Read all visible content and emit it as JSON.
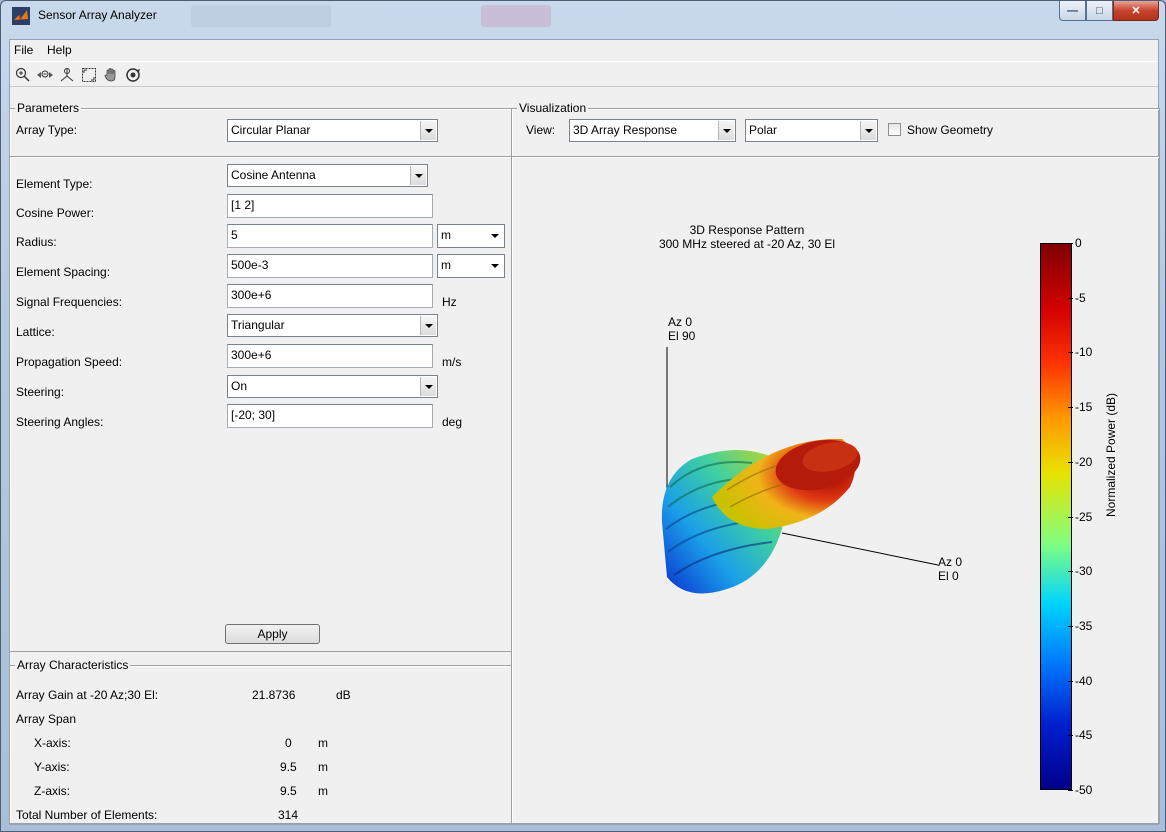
{
  "window": {
    "title": "Sensor Array Analyzer"
  },
  "menu": {
    "file": "File",
    "help": "Help"
  },
  "toolbar": [
    "zoom-in",
    "zoom-out",
    "pan",
    "zoom-fit",
    "hand",
    "rotate-3d"
  ],
  "parameters": {
    "legend": "Parameters",
    "array_type_label": "Array Type:",
    "array_type_value": "Circular Planar",
    "element_type_label": "Element Type:",
    "element_type_value": "Cosine Antenna",
    "cosine_power_label": "Cosine Power:",
    "cosine_power_value": "[1 2]",
    "radius_label": "Radius:",
    "radius_value": "5",
    "radius_unit": "m",
    "spacing_label": "Element Spacing:",
    "spacing_value": "500e-3",
    "spacing_unit": "m",
    "freq_label": "Signal Frequencies:",
    "freq_value": "300e+6",
    "freq_unit": "Hz",
    "lattice_label": "Lattice:",
    "lattice_value": "Triangular",
    "speed_label": "Propagation Speed:",
    "speed_value": "300e+6",
    "speed_unit": "m/s",
    "steering_label": "Steering:",
    "steering_value": "On",
    "angles_label": "Steering Angles:",
    "angles_value": "[-20; 30]",
    "angles_unit": "deg",
    "apply_label": "Apply"
  },
  "characteristics": {
    "legend": "Array Characteristics",
    "gain_label": "Array Gain at -20 Az;30 El:",
    "gain_value": "21.8736",
    "gain_unit": "dB",
    "span_label": "Array Span",
    "x_label": "X-axis:",
    "x_value": "0",
    "x_unit": "m",
    "y_label": "Y-axis:",
    "y_value": "9.5",
    "y_unit": "m",
    "z_label": "Z-axis:",
    "z_value": "9.5",
    "z_unit": "m",
    "total_label": "Total Number of Elements:",
    "total_value": "314"
  },
  "visualization": {
    "legend": "Visualization",
    "view_label": "View:",
    "view_value": "3D Array Response",
    "mode_value": "Polar",
    "show_geometry_label": "Show Geometry",
    "show_geometry_checked": false,
    "plot_title_1": "3D Response Pattern",
    "plot_title_2": "300 MHz steered at -20 Az, 30 El",
    "axis_top_1": "Az 0",
    "axis_top_2": "El 90",
    "axis_side_1": "Az 0",
    "axis_side_2": "El 0",
    "colorbar_label": "Normalized Power (dB)",
    "colorbar_ticks": [
      "0",
      "-5",
      "-10",
      "-15",
      "-20",
      "-25",
      "-30",
      "-35",
      "-40",
      "-45",
      "-50"
    ],
    "colorbar_range": [
      -50,
      0
    ]
  }
}
